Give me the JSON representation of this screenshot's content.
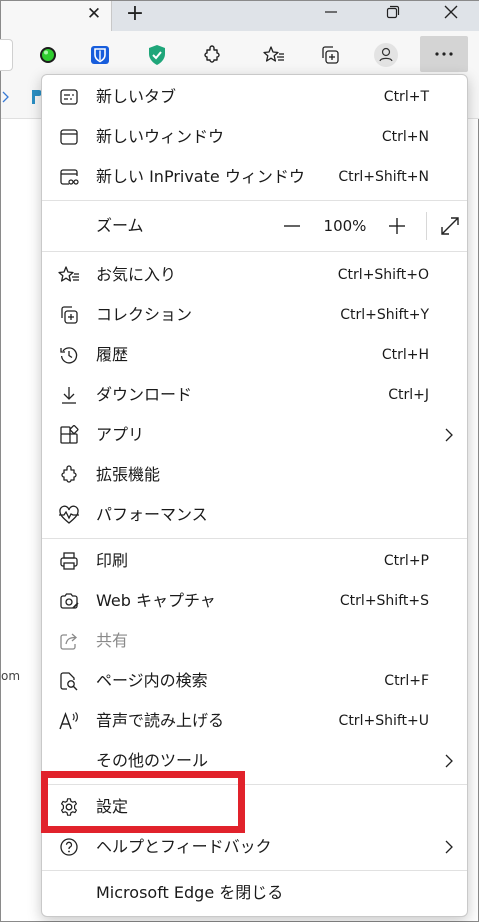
{
  "menu": {
    "items": [
      {
        "label": "新しいタブ",
        "shortcut": "Ctrl+T"
      },
      {
        "label": "新しいウィンドウ",
        "shortcut": "Ctrl+N"
      },
      {
        "label": "新しい InPrivate ウィンドウ",
        "shortcut": "Ctrl+Shift+N"
      },
      {
        "label": "ズーム",
        "shortcut": ""
      },
      {
        "label": "お気に入り",
        "shortcut": "Ctrl+Shift+O"
      },
      {
        "label": "コレクション",
        "shortcut": "Ctrl+Shift+Y"
      },
      {
        "label": "履歴",
        "shortcut": "Ctrl+H"
      },
      {
        "label": "ダウンロード",
        "shortcut": "Ctrl+J"
      },
      {
        "label": "アプリ",
        "shortcut": ""
      },
      {
        "label": "拡張機能",
        "shortcut": ""
      },
      {
        "label": "パフォーマンス",
        "shortcut": ""
      },
      {
        "label": "印刷",
        "shortcut": "Ctrl+P"
      },
      {
        "label": "Web キャプチャ",
        "shortcut": "Ctrl+Shift+S"
      },
      {
        "label": "共有",
        "shortcut": ""
      },
      {
        "label": "ページ内の検索",
        "shortcut": "Ctrl+F"
      },
      {
        "label": "音声で読み上げる",
        "shortcut": "Ctrl+Shift+U"
      },
      {
        "label": "その他のツール",
        "shortcut": ""
      },
      {
        "label": "設定",
        "shortcut": ""
      },
      {
        "label": "ヘルプとフィードバック",
        "shortcut": ""
      },
      {
        "label": "Microsoft Edge を閉じる",
        "shortcut": ""
      }
    ],
    "zoom_value": "100%"
  },
  "page": {
    "side_text": "om"
  },
  "colors": {
    "highlight": "#e1222b",
    "menu_bg": "#ffffff",
    "more_button_bg": "#d4d4d4",
    "shield_green": "#1fa67a",
    "bitwarden_blue": "#175ddc"
  },
  "icons": {
    "toolbar": [
      "green-circle-icon",
      "bitwarden-icon",
      "shield-check-icon",
      "extensions-icon",
      "favorites-icon",
      "collections-icon",
      "profile-icon",
      "more-icon"
    ]
  }
}
